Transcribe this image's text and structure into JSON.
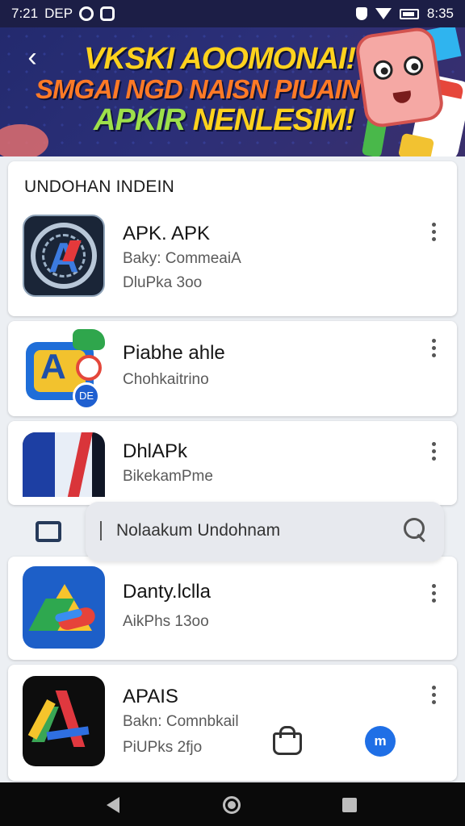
{
  "status_bar": {
    "time": "7:21",
    "left_text": "DEP",
    "right_time": "8:35",
    "icons": [
      "notification-circle-icon",
      "shield-notif-icon",
      "vpn-icon",
      "wifi-icon",
      "battery-icon"
    ]
  },
  "banner": {
    "line1": "VKSKI AOOMONAI!",
    "line2": "SMGAI NGD NAISN PIUAIN",
    "line3a": "APKIR",
    "line3b": " NENLESIM!",
    "back_icon": "back-arrow-icon"
  },
  "list": {
    "section_title": "UNDOHAN INDEIN",
    "apps": [
      {
        "name": "APK. APK",
        "meta1": "Baky: CommeaiA",
        "meta2": "DluPka 3oo"
      },
      {
        "name": "Piabhe ahle",
        "meta1": "Chohkaitrino",
        "meta2": ""
      },
      {
        "name": "DhlAPk",
        "meta1": "BikekamPme",
        "meta2": ""
      },
      {
        "name": "Danty.lclla",
        "meta1": "AikPhs 13oo",
        "meta2": ""
      },
      {
        "name": "APAIS",
        "meta1": "Bakn: Comnbkail",
        "meta2": "PiUPks 2fjo"
      }
    ]
  },
  "search": {
    "text": "Nolaakum Undohnam",
    "icon": "search-icon"
  },
  "extra": {
    "badge_label": "m"
  },
  "colors": {
    "status_bg": "#1c1e46",
    "banner_bg": "#232a6e",
    "accent_blue": "#1f6fe6",
    "page_bg": "#eceff3"
  }
}
